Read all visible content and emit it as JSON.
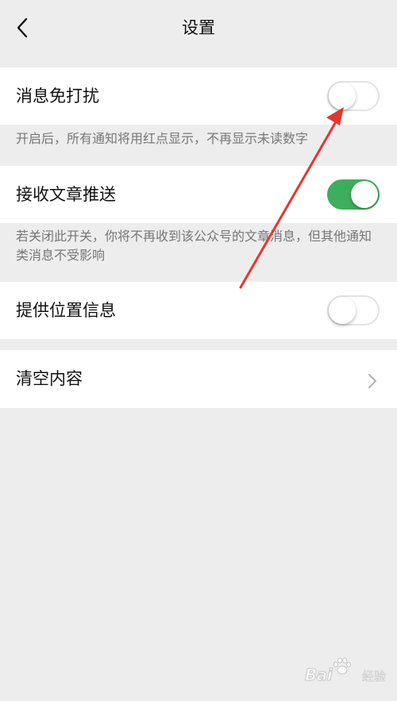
{
  "header": {
    "title": "设置"
  },
  "settings": {
    "dnd": {
      "label": "消息免打扰",
      "enabled": false,
      "note": "开启后，所有通知将用红点显示，不再显示未读数字"
    },
    "articles": {
      "label": "接收文章推送",
      "enabled": true,
      "note": "若关闭此开关，你将不再收到该公众号的文章消息，但其他通知类消息不受影响"
    },
    "location": {
      "label": "提供位置信息",
      "enabled": false
    },
    "clear": {
      "label": "清空内容"
    }
  },
  "colors": {
    "toggle_on": "#3dae5b",
    "background": "#ededed",
    "annotation_arrow": "#e8352b"
  },
  "icons": {
    "back": "chevron-left-icon",
    "row_arrow": "chevron-right-icon"
  },
  "watermark": {
    "text": "Bai",
    "text2": "经验"
  }
}
